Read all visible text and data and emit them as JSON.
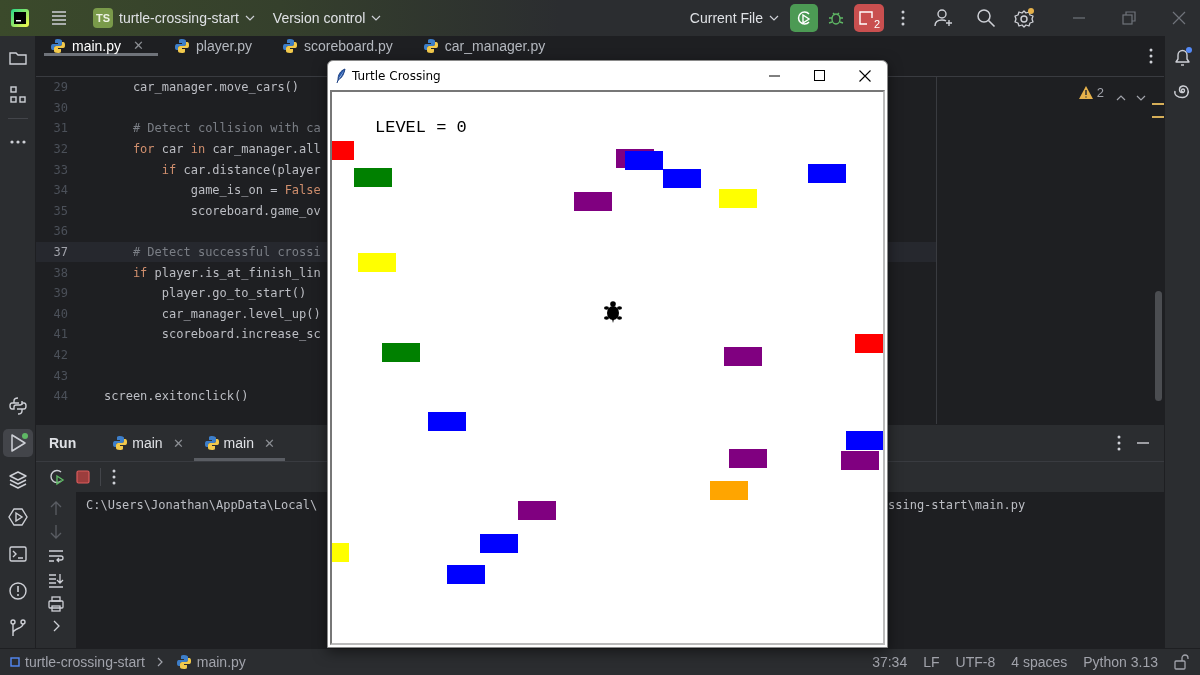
{
  "title_bar": {
    "project_badge": "TS",
    "project": "turtle-crossing-start",
    "vcs": "Version control",
    "run_config": "Current File",
    "stop_count": "2"
  },
  "left_tools_top": [
    {
      "kind": "project",
      "selected": false
    },
    {
      "kind": "structure",
      "selected": false
    },
    {
      "kind": "more",
      "selected": false
    }
  ],
  "left_tools_bottom": [
    {
      "kind": "python_console",
      "selected": false
    },
    {
      "kind": "run",
      "selected": true
    },
    {
      "kind": "layers",
      "selected": false
    },
    {
      "kind": "services",
      "selected": false
    },
    {
      "kind": "terminal",
      "selected": false
    },
    {
      "kind": "problems",
      "selected": false
    },
    {
      "kind": "git",
      "selected": false
    }
  ],
  "editor_tabs": [
    {
      "label": "main.py",
      "selected": true,
      "close": "✕"
    },
    {
      "label": "player.py",
      "selected": false
    },
    {
      "label": "scoreboard.py",
      "selected": false
    },
    {
      "label": "car_manager.py",
      "selected": false
    }
  ],
  "code_lines": [
    {
      "number": "29",
      "current": false,
      "tokens": [
        {
          "kind": "plain",
          "text": "    car_manager.move_cars()"
        }
      ]
    },
    {
      "number": "30",
      "current": false
    },
    {
      "number": "31",
      "current": false,
      "tokens": [
        {
          "kind": "comment",
          "text": "    # Detect collision with ca"
        }
      ]
    },
    {
      "number": "32",
      "current": false,
      "tokens": [
        {
          "kind": "keyword",
          "text": "    for"
        },
        {
          "kind": "plain",
          "text": " car "
        },
        {
          "kind": "keyword",
          "text": "in"
        },
        {
          "kind": "plain",
          "text": " car_manager.all"
        }
      ]
    },
    {
      "number": "33",
      "current": false,
      "tokens": [
        {
          "kind": "keyword",
          "text": "        if"
        },
        {
          "kind": "plain",
          "text": " car.distance(player"
        }
      ]
    },
    {
      "number": "34",
      "current": false,
      "tokens": [
        {
          "kind": "plain",
          "text": "            game_is_on = "
        },
        {
          "kind": "keyword",
          "text": "False"
        }
      ]
    },
    {
      "number": "35",
      "current": false,
      "tokens": [
        {
          "kind": "plain",
          "text": "            scoreboard.game_ov"
        }
      ]
    },
    {
      "number": "36",
      "current": false
    },
    {
      "number": "37",
      "current": true,
      "tokens": [
        {
          "kind": "comment",
          "text": "    # Detect successful crossi"
        }
      ]
    },
    {
      "number": "38",
      "current": false,
      "tokens": [
        {
          "kind": "keyword",
          "text": "    if"
        },
        {
          "kind": "plain",
          "text": " player.is_at_finish_lin"
        }
      ]
    },
    {
      "number": "39",
      "current": false,
      "tokens": [
        {
          "kind": "plain",
          "text": "        player.go_to_start()"
        }
      ]
    },
    {
      "number": "40",
      "current": false,
      "tokens": [
        {
          "kind": "plain",
          "text": "        car_manager.level_up()"
        }
      ]
    },
    {
      "number": "41",
      "current": false,
      "tokens": [
        {
          "kind": "plain",
          "text": "        scoreboard.increase_sc"
        }
      ]
    },
    {
      "number": "42",
      "current": false
    },
    {
      "number": "43",
      "current": false
    },
    {
      "number": "44",
      "current": false,
      "tokens": [
        {
          "kind": "plain",
          "text": "screen.exitonclick()"
        }
      ]
    }
  ],
  "inspections": {
    "warnings": "2"
  },
  "run_panel": {
    "title": "Run",
    "tabs": [
      {
        "label": "main",
        "selected": false,
        "close": "✕"
      },
      {
        "label": "main",
        "selected": true,
        "close": "✕"
      }
    ],
    "console_lines": [
      {
        "left": "C:\\Users\\Jonathan\\AppData\\Local\\",
        "right": "ssing-start\\main.py"
      }
    ]
  },
  "status_bar": {
    "breadcrumbs": [
      "turtle-crossing-start",
      "main.py"
    ],
    "items": [
      "37:34",
      "LF",
      "UTF-8",
      "4 spaces",
      "Python 3.13"
    ]
  },
  "turtle_window": {
    "title": "Turtle Crossing",
    "level_text": "LEVEL = 0",
    "cars": [
      {
        "color": "#ff0000"
      },
      {
        "color": "#800080"
      },
      {
        "color": "#0000ff"
      },
      {
        "color": "#008000"
      },
      {
        "color": "#0000ff"
      },
      {
        "color": "#0000ff"
      },
      {
        "color": "#800080"
      },
      {
        "color": "#ffff00"
      },
      {
        "color": "#ffff00"
      },
      {
        "color": "#008000"
      },
      {
        "color": "#ff0000"
      },
      {
        "color": "#800080"
      },
      {
        "color": "#0000ff"
      },
      {
        "color": "#0000ff"
      },
      {
        "color": "#800080"
      },
      {
        "color": "#800080"
      },
      {
        "color": "#ffa500"
      },
      {
        "color": "#800080"
      },
      {
        "color": "#0000ff"
      },
      {
        "color": "#ffff00"
      },
      {
        "color": "#0000ff"
      }
    ]
  }
}
